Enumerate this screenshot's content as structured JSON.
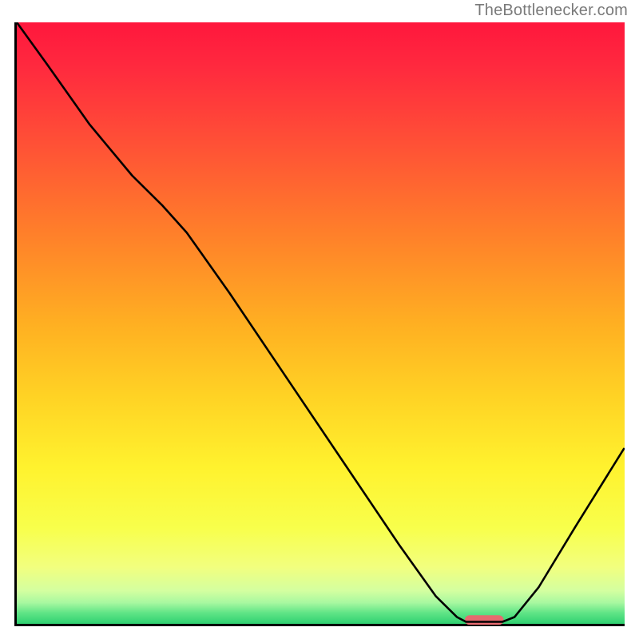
{
  "attribution": "TheBottlenecker.com",
  "chart_data": {
    "type": "line",
    "title": "",
    "xlabel": "",
    "ylabel": "",
    "xlim": [
      0,
      100
    ],
    "ylim": [
      0,
      100
    ],
    "grid": false,
    "legend": false,
    "background_gradient_stops": [
      {
        "offset": 0.0,
        "color": "#ff173d"
      },
      {
        "offset": 0.08,
        "color": "#ff2b3e"
      },
      {
        "offset": 0.2,
        "color": "#ff5036"
      },
      {
        "offset": 0.35,
        "color": "#ff7f2a"
      },
      {
        "offset": 0.5,
        "color": "#ffaf22"
      },
      {
        "offset": 0.62,
        "color": "#ffd224"
      },
      {
        "offset": 0.74,
        "color": "#fff22e"
      },
      {
        "offset": 0.84,
        "color": "#f8ff4b"
      },
      {
        "offset": 0.905,
        "color": "#f2ff7e"
      },
      {
        "offset": 0.945,
        "color": "#d4ffa0"
      },
      {
        "offset": 0.965,
        "color": "#a7f8a0"
      },
      {
        "offset": 0.982,
        "color": "#5fe486"
      },
      {
        "offset": 1.0,
        "color": "#2fd171"
      }
    ],
    "curve_points": [
      {
        "x": 0.0,
        "y": 100.0
      },
      {
        "x": 5.0,
        "y": 93.0
      },
      {
        "x": 12.0,
        "y": 83.0
      },
      {
        "x": 19.0,
        "y": 74.5
      },
      {
        "x": 24.0,
        "y": 69.5
      },
      {
        "x": 28.0,
        "y": 65.0
      },
      {
        "x": 35.0,
        "y": 55.0
      },
      {
        "x": 45.0,
        "y": 40.0
      },
      {
        "x": 55.0,
        "y": 25.0
      },
      {
        "x": 63.0,
        "y": 13.0
      },
      {
        "x": 69.0,
        "y": 4.5
      },
      {
        "x": 72.5,
        "y": 1.0
      },
      {
        "x": 74.0,
        "y": 0.2
      },
      {
        "x": 80.0,
        "y": 0.2
      },
      {
        "x": 82.0,
        "y": 1.0
      },
      {
        "x": 86.0,
        "y": 6.0
      },
      {
        "x": 92.0,
        "y": 16.0
      },
      {
        "x": 100.0,
        "y": 29.0
      }
    ],
    "marker": {
      "x_center": 77.0,
      "x_halfwidth": 3.2,
      "y": 0.5,
      "color": "#e66a6f",
      "thickness": 1.6
    },
    "axis": {
      "stroke": "#000000",
      "width": 3
    },
    "curve_style": {
      "stroke": "#000000",
      "width": 2.6
    }
  }
}
